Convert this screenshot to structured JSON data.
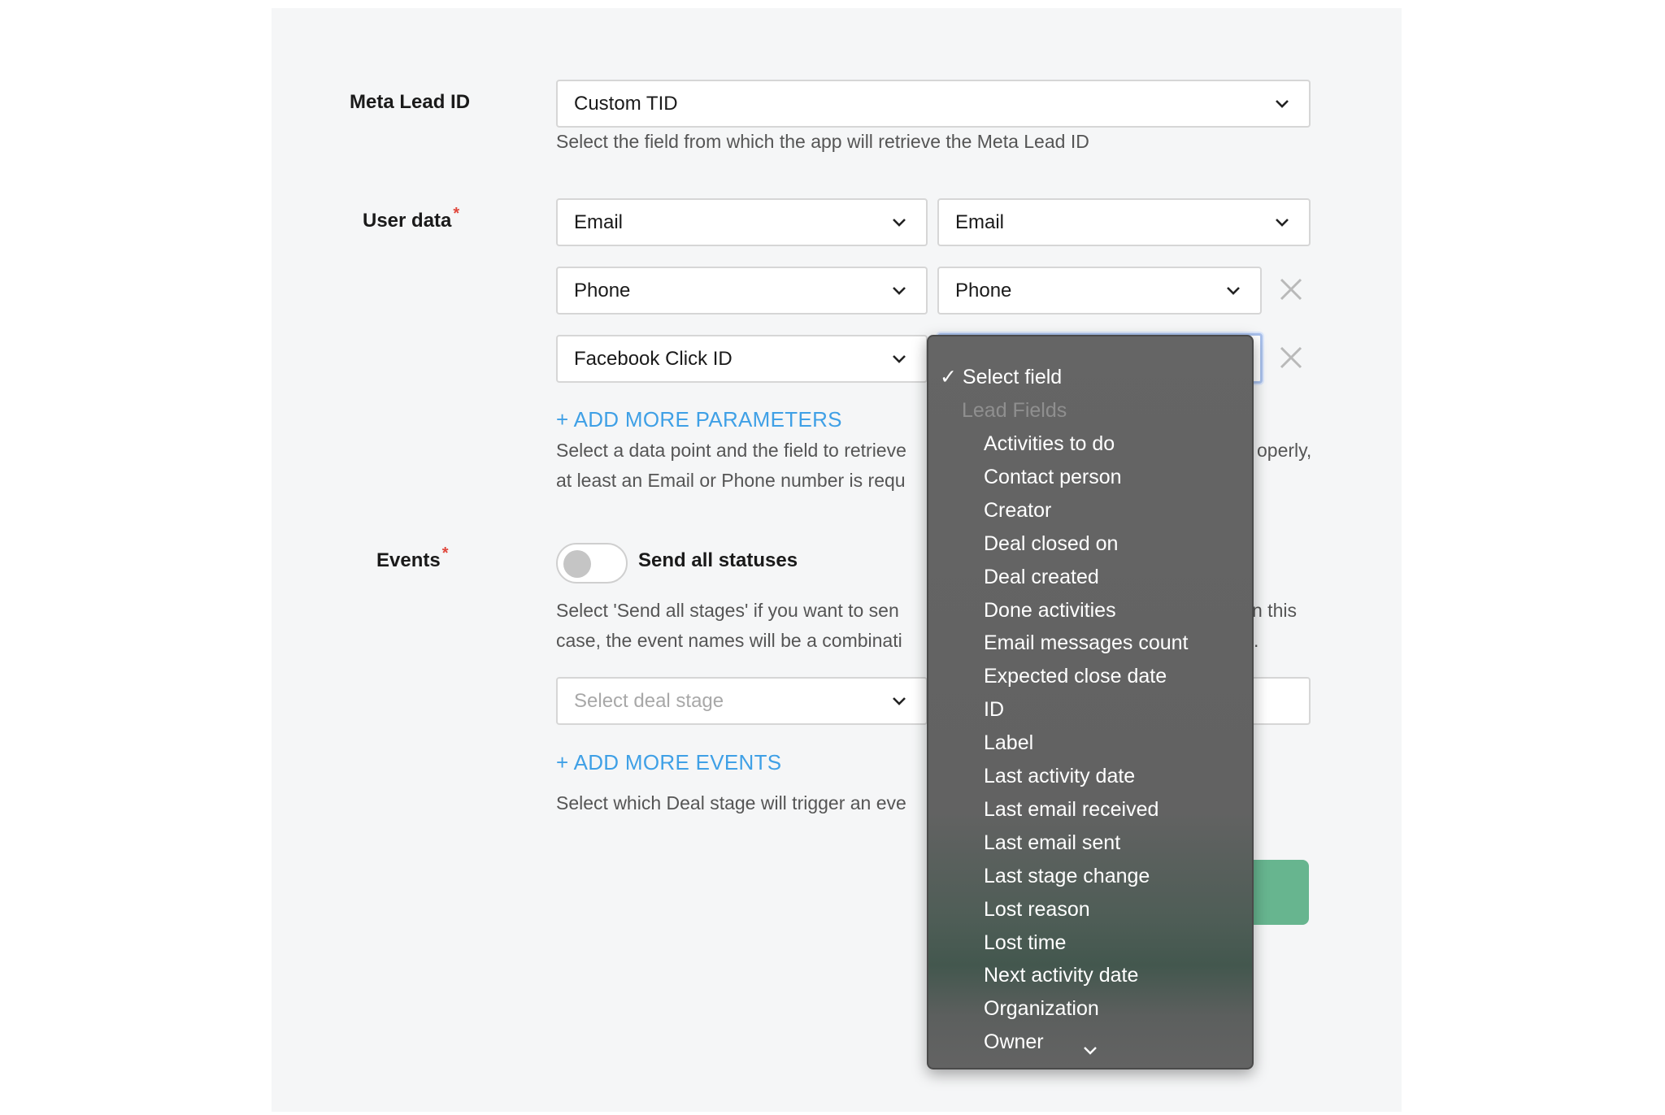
{
  "meta_lead": {
    "label": "Meta Lead ID",
    "value": "Custom TID",
    "help": "Select the field from which the app will retrieve the Meta Lead ID"
  },
  "user_data": {
    "label": "User data",
    "required_mark": "*",
    "rows": [
      {
        "left": "Email",
        "right": "Email"
      },
      {
        "left": "Phone",
        "right": "Phone"
      },
      {
        "left": "Facebook Click ID",
        "right": ""
      }
    ],
    "add_more": "+ ADD MORE PARAMETERS",
    "help_line1_left": "Select a data point and the field to retrieve",
    "help_line1_right": "operly,",
    "help_line2_left": "at least an Email or Phone number is requ"
  },
  "events": {
    "label": "Events",
    "required_mark": "*",
    "toggle_label": "Send all statuses",
    "toggle_on": false,
    "help_line1_left": "Select 'Send all stages' if you want to sen",
    "help_line1_right": "n this",
    "help_line2_left": "case, the event names will be a combinati",
    "help_line2_right": ".",
    "stage_placeholder": "Select deal stage",
    "add_more": "+ ADD MORE EVENTS",
    "help_bottom": "Select which Deal stage will trigger an eve"
  },
  "dropdown": {
    "selected": "✓ Select field",
    "group_label": "Lead Fields",
    "options": [
      "Activities to do",
      "Contact person",
      "Creator",
      "Deal closed on",
      "Deal created",
      "Done activities",
      "Email messages count",
      "Expected close date",
      "ID",
      "Label",
      "Last activity date",
      "Last email received",
      "Last email sent",
      "Last stage change",
      "Lost reason",
      "Lost time",
      "Next activity date",
      "Organization",
      "Owner"
    ]
  },
  "colors": {
    "link": "#3fa0e6",
    "required": "#e0473c",
    "button_green": "#67b58f",
    "dropdown_bg": "#656565"
  }
}
